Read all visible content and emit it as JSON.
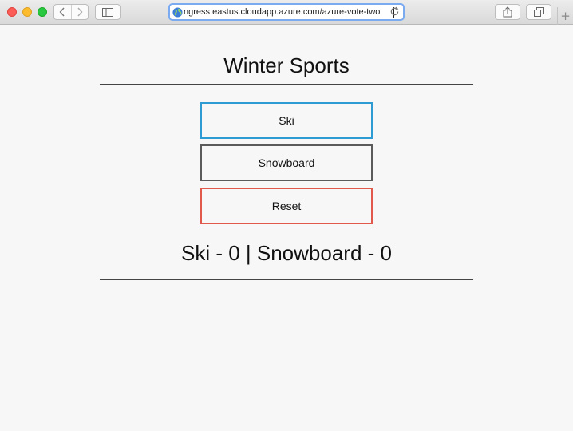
{
  "browser": {
    "url_display": "ngress.eastus.cloudapp.azure.com/azure-vote-two"
  },
  "page": {
    "title": "Winter Sports",
    "buttons": [
      {
        "label": "Ski",
        "color": "#2f9bd3"
      },
      {
        "label": "Snowboard",
        "color": "#5b5b5b"
      },
      {
        "label": "Reset",
        "color": "#e0594b"
      }
    ],
    "results": "Ski - 0 | Snowboard - 0"
  },
  "icons": [
    "back-icon",
    "forward-icon",
    "sidebar-icon",
    "globe-icon",
    "reload-icon",
    "share-icon",
    "tabs-icon",
    "new-tab-icon"
  ]
}
